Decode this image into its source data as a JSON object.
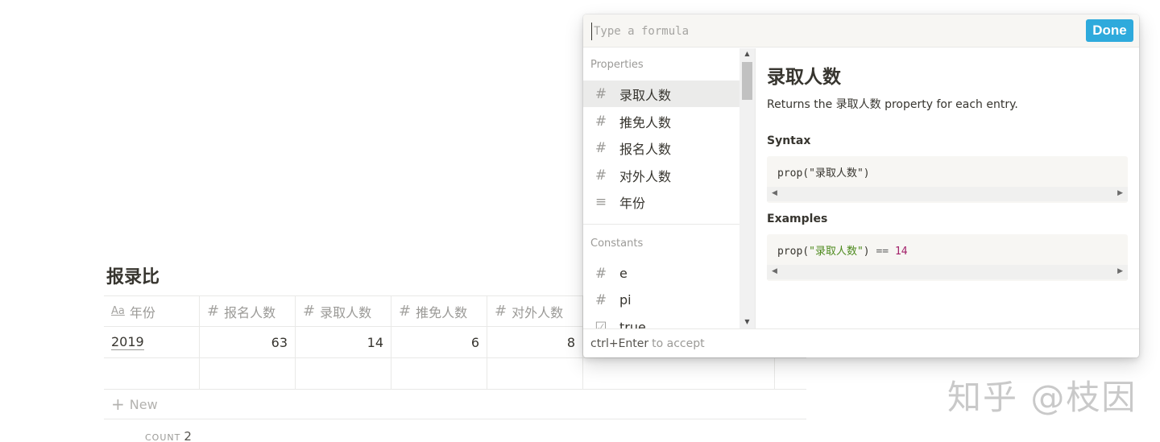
{
  "database": {
    "title": "报录比",
    "columns": [
      {
        "icon": "Aa",
        "label": "年份"
      },
      {
        "icon": "#",
        "label": "报名人数"
      },
      {
        "icon": "#",
        "label": "录取人数"
      },
      {
        "icon": "#",
        "label": "推免人数"
      },
      {
        "icon": "#",
        "label": "对外人数"
      }
    ],
    "rows": [
      {
        "year": "2019",
        "applicants": "63",
        "admitted": "14",
        "exempted": "6",
        "external": "8"
      }
    ],
    "new_label": "New",
    "count_label": "COUNT",
    "count_value": "2"
  },
  "formula": {
    "placeholder": "Type a formula",
    "done_label": "Done",
    "properties_label": "Properties",
    "properties": [
      {
        "icon": "#",
        "label": "录取人数"
      },
      {
        "icon": "#",
        "label": "推免人数"
      },
      {
        "icon": "#",
        "label": "报名人数"
      },
      {
        "icon": "#",
        "label": "对外人数"
      },
      {
        "icon": "≡",
        "label": "年份"
      }
    ],
    "constants_label": "Constants",
    "constants": [
      {
        "icon": "#",
        "label": "e"
      },
      {
        "icon": "#",
        "label": "pi"
      },
      {
        "icon": "☑",
        "label": "true"
      }
    ],
    "detail": {
      "title": "录取人数",
      "desc_prefix": "Returns the ",
      "desc_prop": "录取人数",
      "desc_suffix": " property for each entry.",
      "syntax_label": "Syntax",
      "syntax_code": "prop(\"录取人数\")",
      "examples_label": "Examples",
      "example_fn": "prop(",
      "example_str": "\"录取人数\"",
      "example_close": ")",
      "example_op": " == ",
      "example_num": "14"
    },
    "footer_keys": "ctrl+Enter",
    "footer_text": "to accept"
  },
  "watermark": "知乎 @枝因",
  "colors": {
    "accent": "#2eaadc",
    "text": "#37352f",
    "muted": "#9b9a97"
  }
}
